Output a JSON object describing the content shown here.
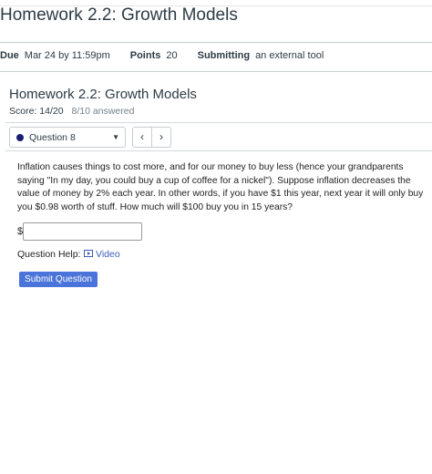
{
  "header": {
    "title": "Homework 2.2: Growth Models",
    "due_label": "Due",
    "due_value": "Mar 24 by 11:59pm",
    "points_label": "Points",
    "points_value": "20",
    "submitting_label": "Submitting",
    "submitting_value": "an external tool"
  },
  "assignment": {
    "title": "Homework 2.2: Growth Models",
    "score": "Score: 14/20",
    "answered": "8/10 answered"
  },
  "question_nav": {
    "selected": "Question 8",
    "status_color": "#1a1f71",
    "prev_icon": "chevron-left",
    "next_icon": "chevron-right"
  },
  "question": {
    "text": "Inflation causes things to cost more, and for our money to buy less (hence your grandparents saying \"In my day, you could buy a cup of coffee for a nickel\"). Suppose inflation decreases the value of money by 2% each year. In other words, if you have $1 this year, next year it will only buy you $0.98 worth of stuff. How much will $100 buy you in 15 years?",
    "currency_prefix": "$",
    "answer_value": ""
  },
  "help": {
    "label": "Question Help:",
    "video_label": "Video"
  },
  "actions": {
    "submit_label": "Submit Question"
  }
}
